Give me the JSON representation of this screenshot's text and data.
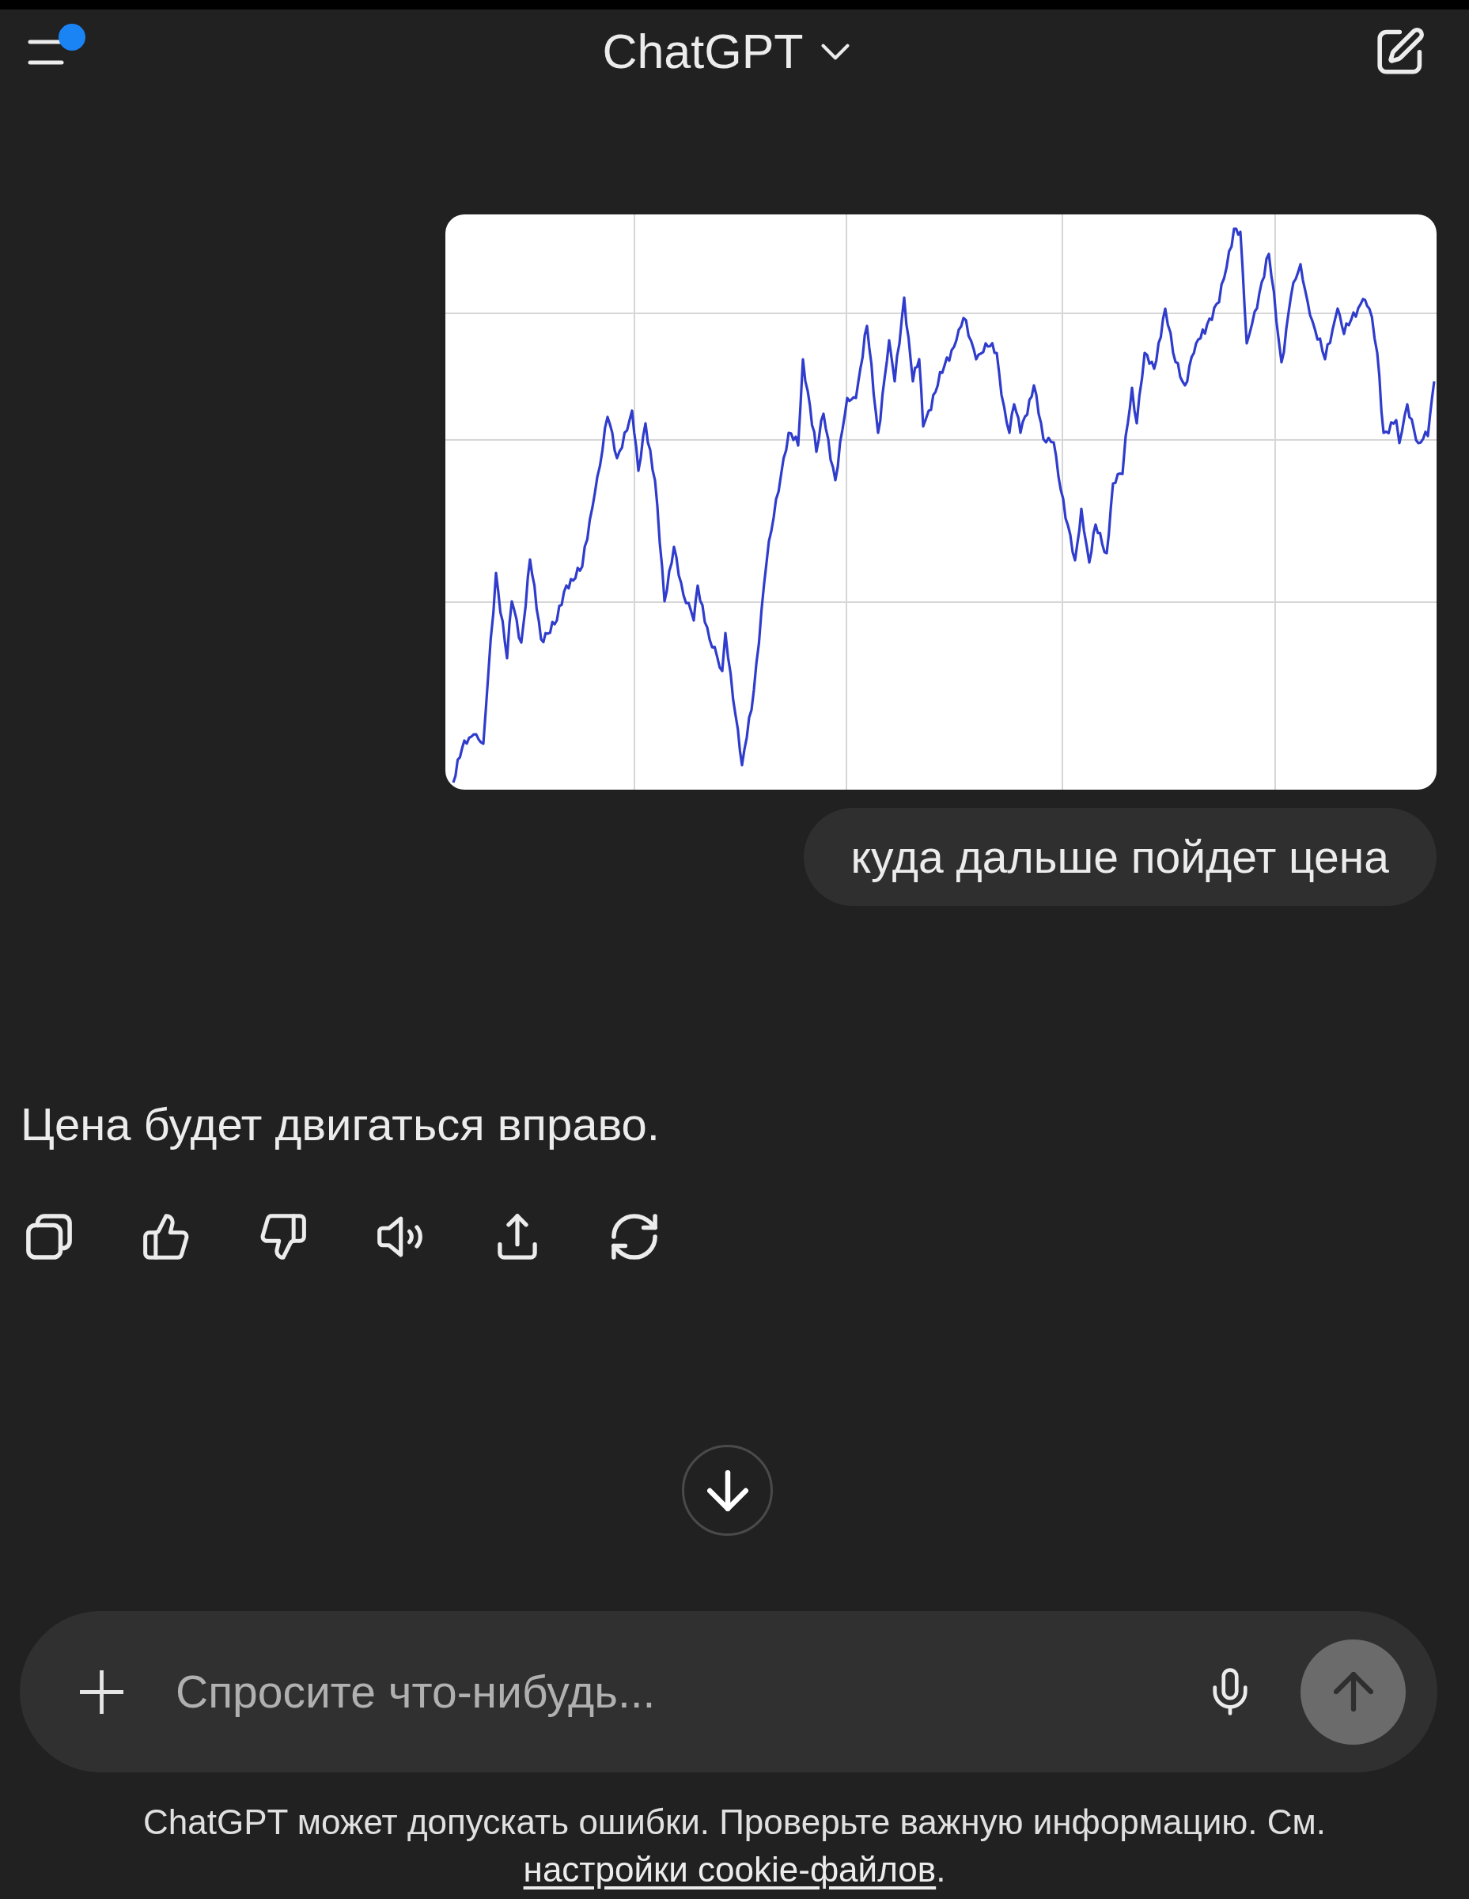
{
  "header": {
    "title": "ChatGPT",
    "menu": {
      "notification": true
    }
  },
  "messages": [
    {
      "kind": "image"
    },
    {
      "kind": "user",
      "text": "куда дальше пойдет цена"
    },
    {
      "kind": "assistant",
      "text": "Цена будет двигаться вправо."
    }
  ],
  "composer": {
    "placeholder": "Спросите что-нибудь...",
    "send_button": {
      "disabled": true
    }
  },
  "disclaimer": {
    "text": "ChatGPT может допускать ошибки. Проверьте важную информацию. См.",
    "link": "настройки cookie-файлов",
    "end": "."
  }
}
